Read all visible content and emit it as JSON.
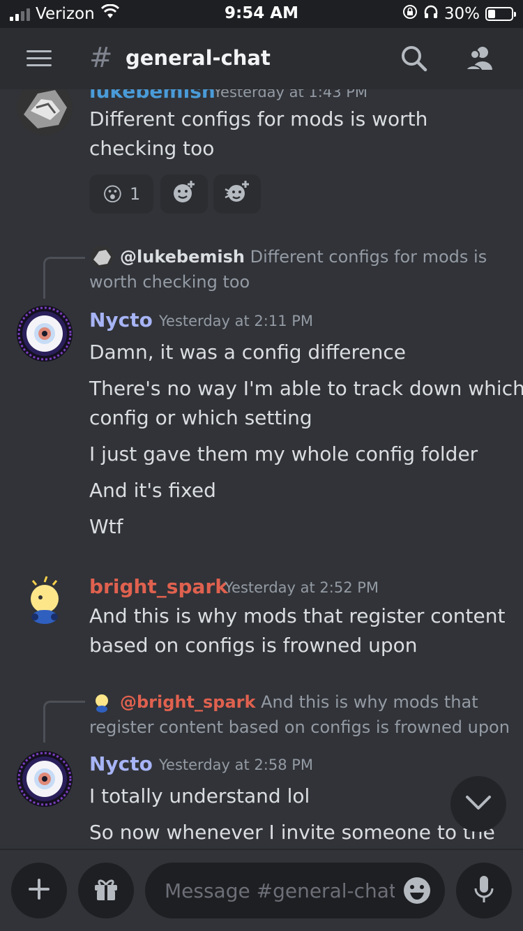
{
  "status_bar": {
    "carrier": "Verizon",
    "time": "9:54 AM",
    "battery": "30%"
  },
  "header": {
    "hash": "#",
    "channel": "general-chat",
    "icons": [
      "menu-icon",
      "search-icon",
      "members-icon"
    ]
  },
  "messages": {
    "m0": {
      "author": "lukebemish",
      "timestamp": "Yesterday at 1:43 PM",
      "lines": [
        "Different configs for mods is worth",
        "checking too"
      ],
      "reactions": [
        {
          "emoji": "😮",
          "count": "1"
        },
        {
          "icon": "add-reaction-icon"
        },
        {
          "icon": "add-super-reaction-icon"
        }
      ]
    },
    "m1": {
      "reply_to_user": "@lukebemish",
      "reply_line1": "Different configs for mods is",
      "reply_line2": "worth checking too",
      "author": "Nycto",
      "timestamp": "Yesterday at 2:11 PM",
      "lines": [
        "Damn, it was a config difference",
        "There's no way I'm able to track down which",
        "config or which setting",
        "I just gave them my whole config folder",
        "And it's fixed",
        "Wtf"
      ]
    },
    "m2": {
      "author": "bright_spark",
      "timestamp": "Yesterday at 2:52 PM",
      "lines": [
        "And this is why mods that register content",
        "based on configs is frowned upon"
      ]
    },
    "m3": {
      "reply_to_user": "@bright_spark",
      "reply_line1": "And this is why mods that",
      "reply_line2": "register content based on configs is frowned upon",
      "author": "Nycto",
      "timestamp": "Yesterday at 2:58 PM",
      "lines": [
        "I totally understand lol",
        "So now whenever I invite someone to the"
      ]
    }
  },
  "composer": {
    "placeholder": "Message #general-chat"
  },
  "colors": {
    "nycto": "#a7b4f6",
    "bright_spark": "#e0614f",
    "lukebemish": "#4a9bd8"
  }
}
